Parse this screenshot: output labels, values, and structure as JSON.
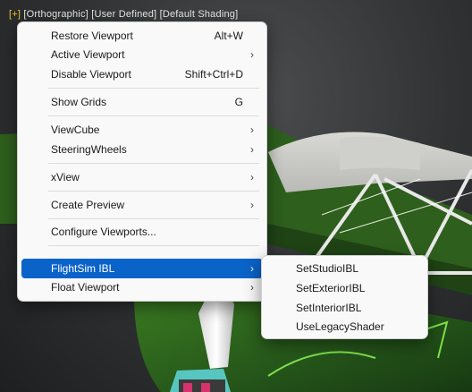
{
  "viewport": {
    "label_plus": "[+]",
    "label_view": "[Orthographic]",
    "label_mode": "[User Defined]",
    "label_shading": "[Default Shading]"
  },
  "context_menu": {
    "items": [
      {
        "label": "Restore Viewport",
        "shortcut": "Alt+W"
      },
      {
        "label": "Active Viewport",
        "arrow": "›"
      },
      {
        "label": "Disable Viewport",
        "shortcut": "Shift+Ctrl+D"
      },
      {
        "label": "Show Grids",
        "shortcut": "G"
      },
      {
        "label": "ViewCube",
        "arrow": "›"
      },
      {
        "label": "SteeringWheels",
        "arrow": "›"
      },
      {
        "label": "xView",
        "arrow": "›"
      },
      {
        "label": "Create Preview",
        "arrow": "›"
      },
      {
        "label": "Configure Viewports..."
      },
      {
        "label": "FlightSim IBL",
        "arrow": "›",
        "highlighted": true
      },
      {
        "label": "Float Viewport",
        "arrow": "›"
      }
    ]
  },
  "submenu": {
    "items": [
      {
        "label": "SetStudioIBL"
      },
      {
        "label": "SetExteriorIBL"
      },
      {
        "label": "SetInteriorIBL"
      },
      {
        "label": "UseLegacyShader"
      }
    ]
  },
  "colors": {
    "highlight": "#0a63c9",
    "menu_bg": "#f9f9f9",
    "plane_green": "#2f6b1a",
    "viewport_label_plus": "#f1c232"
  }
}
